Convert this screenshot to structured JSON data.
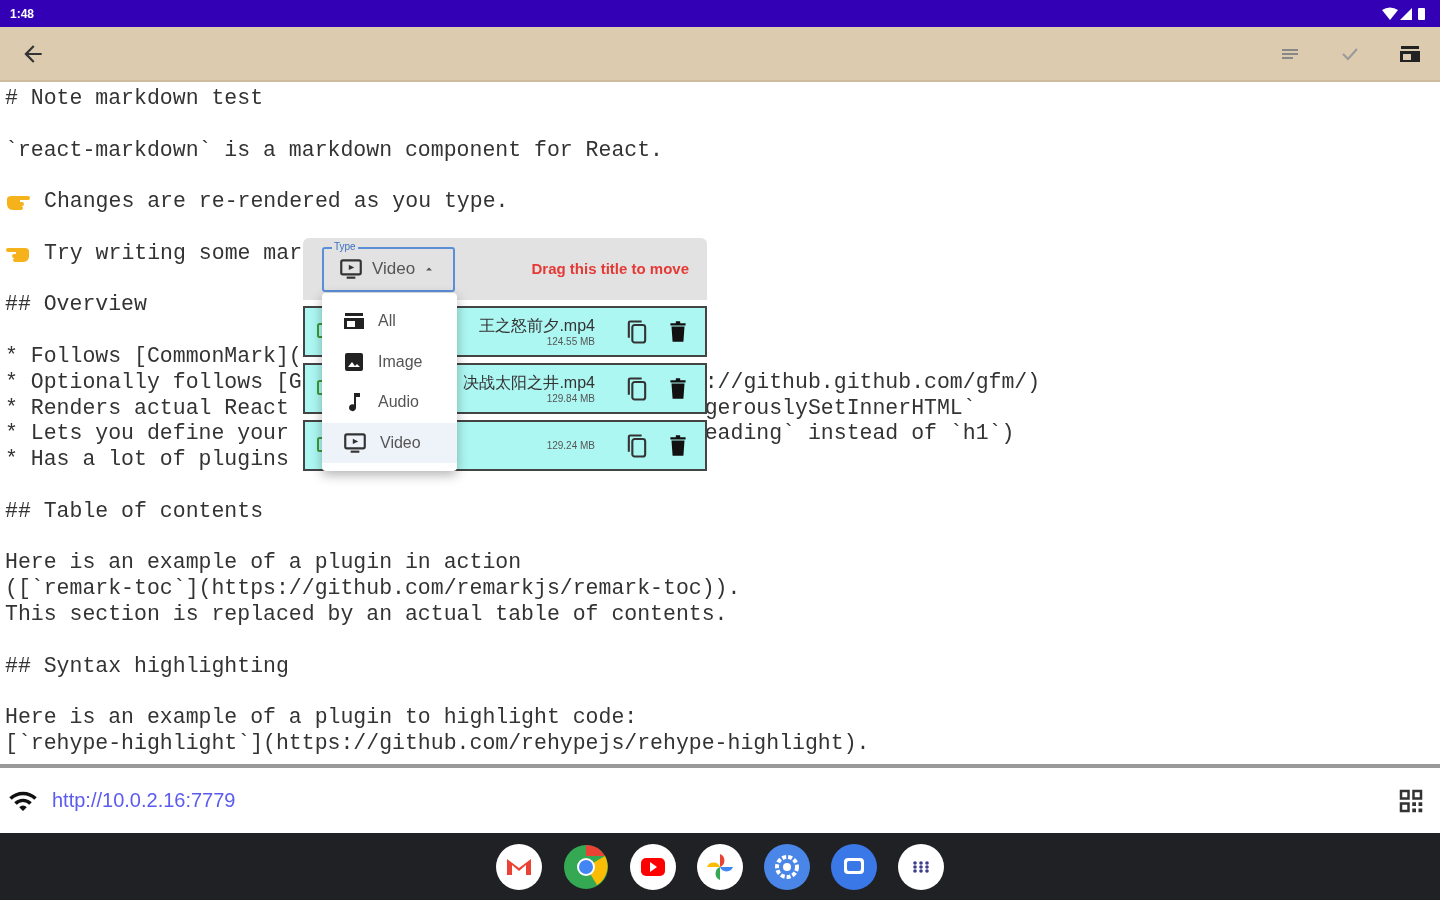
{
  "status_bar": {
    "time": "1:48"
  },
  "editor": {
    "blocks": [
      {
        "lines": [
          {
            "text": "# Note markdown test"
          }
        ]
      },
      {
        "lines": [
          {
            "text": "`react-markdown` is a markdown component for React."
          }
        ]
      },
      {
        "lines": [
          {
            "text": "Changes are re-rendered as you type.",
            "kind": "handright"
          }
        ]
      },
      {
        "lines": [
          {
            "text": "Try writing some mar",
            "kind": "handleft"
          }
        ]
      },
      {
        "lines": [
          {
            "text": "## Overview"
          }
        ]
      },
      {
        "lines": [
          {
            "text": "* Follows [CommonMark]("
          },
          {
            "text": "* Optionally follows [G",
            "rest": "://github.github.com/gfm/)"
          },
          {
            "text": "* Renders actual React",
            "rest": "gerouslySetInnerHTML`"
          },
          {
            "text": "* Lets you define your",
            "rest": "eading` instead of `h1`)"
          },
          {
            "text": "* Has a lot of plugins"
          }
        ]
      },
      {
        "lines": [
          {
            "text": "## Table of contents"
          }
        ]
      },
      {
        "lines": [
          {
            "text": "Here is an example of a plugin in action"
          },
          {
            "text": "([`remark-toc`](https://github.com/remarkjs/remark-toc))."
          },
          {
            "text": "This section is replaced by an actual table of contents."
          }
        ]
      },
      {
        "lines": [
          {
            "text": "## Syntax highlighting"
          }
        ]
      },
      {
        "lines": [
          {
            "text": "Here is an example of a plugin to highlight code:"
          },
          {
            "text": "[`rehype-highlight`](https://github.com/rehypejs/rehype-highlight)."
          }
        ]
      }
    ]
  },
  "file_panel": {
    "type_label": "Type",
    "type_value": "Video",
    "expanded": true,
    "hint": "Drag this title to move",
    "menu": [
      {
        "label": "All",
        "kind": "all",
        "selected": false
      },
      {
        "label": "Image",
        "kind": "image",
        "selected": false
      },
      {
        "label": "Audio",
        "kind": "audio",
        "selected": false
      },
      {
        "label": "Video",
        "kind": "video",
        "selected": true
      }
    ],
    "files": [
      {
        "name": "王之怒前夕.mp4",
        "size": "124.55 MB"
      },
      {
        "name": "决战太阳之井.mp4",
        "size": "129.84 MB"
      },
      {
        "size": "129.24 MB"
      }
    ]
  },
  "footer": {
    "url": "http://10.0.2.16:7779"
  }
}
